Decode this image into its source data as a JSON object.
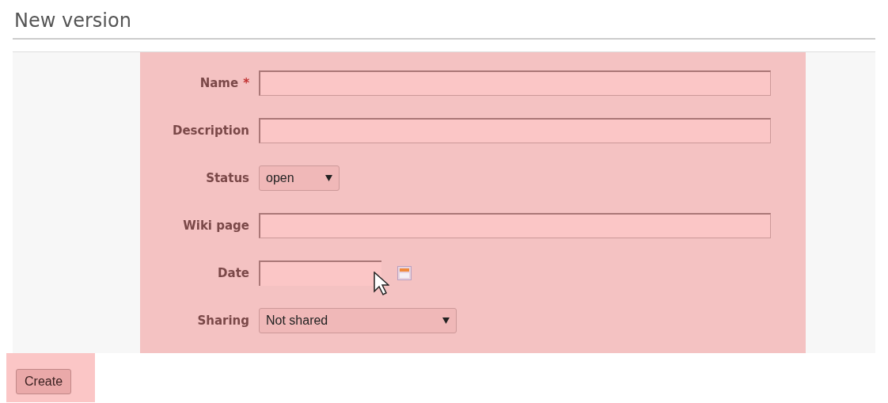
{
  "heading": "New version",
  "fields": [
    {
      "kind": "text",
      "label": "Name",
      "required_mark": "*"
    },
    {
      "kind": "text",
      "label": "Description"
    },
    {
      "kind": "select",
      "label": "Status",
      "value": "open"
    },
    {
      "kind": "text",
      "label": "Wiki page"
    },
    {
      "kind": "date",
      "label": "Date"
    },
    {
      "kind": "select",
      "label": "Sharing",
      "value": "Not shared"
    }
  ],
  "buttons": [
    "Create"
  ]
}
